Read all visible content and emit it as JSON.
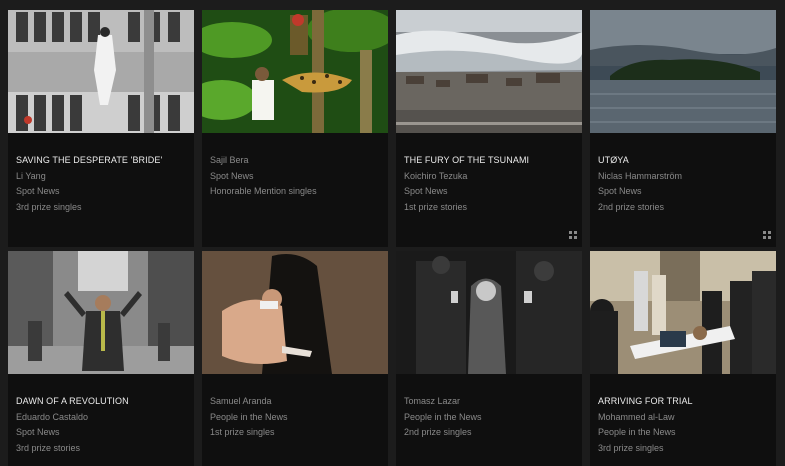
{
  "gallery": {
    "items": [
      {
        "title": "SAVING THE DESPERATE 'BRIDE'",
        "photographer": "Li Yang",
        "category": "Spot News",
        "prize": "3rd prize singles",
        "image": "woman-on-building-facade",
        "stories_icon": false
      },
      {
        "title": "",
        "photographer": "Sajil Bera",
        "category": "Spot News",
        "prize": "Honorable Mention singles",
        "image": "leopard-attacking-man-in-forest",
        "stories_icon": false
      },
      {
        "title": "THE FURY OF THE TSUNAMI",
        "photographer": "Koichiro Tezuka",
        "category": "Spot News",
        "prize": "1st prize stories",
        "image": "tsunami-wave-over-town",
        "stories_icon": true
      },
      {
        "title": "UTØYA",
        "photographer": "Niclas Hammarström",
        "category": "Spot News",
        "prize": "2nd prize stories",
        "image": "island-in-lake",
        "stories_icon": true
      },
      {
        "title": "DAWN OF A REVOLUTION",
        "photographer": "Eduardo Castaldo",
        "category": "Spot News",
        "prize": "3rd prize stories",
        "image": "protester-in-street",
        "stories_icon": false
      },
      {
        "title": "",
        "photographer": "Samuel Aranda",
        "category": "People in the News",
        "prize": "1st prize singles",
        "image": "veiled-woman-holding-man",
        "stories_icon": false
      },
      {
        "title": "",
        "photographer": "Tomasz Lazar",
        "category": "People in the News",
        "prize": "2nd prize singles",
        "image": "police-arresting-woman",
        "stories_icon": false
      },
      {
        "title": "ARRIVING FOR TRIAL",
        "photographer": "Mohammed al-Law",
        "category": "People in the News",
        "prize": "3rd prize singles",
        "image": "man-on-stretcher-with-guards",
        "stories_icon": false
      }
    ]
  }
}
